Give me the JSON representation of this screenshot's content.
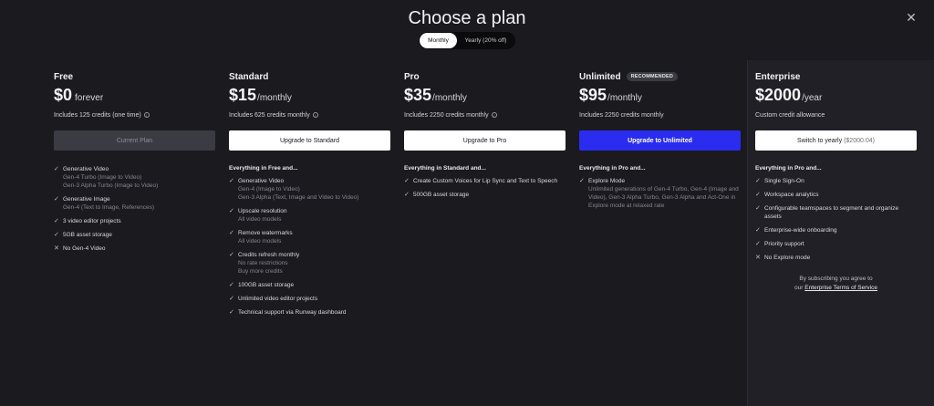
{
  "header": {
    "title": "Choose a plan",
    "close": "✕"
  },
  "billing_toggle": {
    "monthly": "Monthly",
    "yearly": "Yearly (20% off)"
  },
  "plans": {
    "free": {
      "name": "Free",
      "price": "$0",
      "period": "forever",
      "credits": "Includes 125 credits (one time)",
      "button": "Current Plan",
      "features": [
        {
          "label": "Generative Video",
          "subs": [
            "Gen-4 Turbo (Image to Video)",
            "Gen-3 Alpha Turbo (Image to Video)"
          ]
        },
        {
          "label": "Generative Image",
          "subs": [
            "Gen-4 (Text to Image, References)"
          ]
        },
        {
          "label": "3 video editor projects"
        },
        {
          "label": "5GB asset storage"
        },
        {
          "label": "No Gen-4 Video"
        }
      ]
    },
    "standard": {
      "name": "Standard",
      "price": "$15",
      "period": "/monthly",
      "credits": "Includes 625 credits monthly",
      "button": "Upgrade to Standard",
      "features_head": "Everything in Free and...",
      "features": [
        {
          "label": "Generative Video",
          "subs": [
            "Gen-4 (Image to Video)",
            "Gen-3 Alpha (Text, Image and Video to Video)"
          ]
        },
        {
          "label": "Upscale resolution",
          "subs": [
            "All video models"
          ]
        },
        {
          "label": "Remove watermarks",
          "subs": [
            "All video models"
          ]
        },
        {
          "label": "Credits refresh monthly",
          "subs": [
            "No rate restrictions",
            "Buy more credits"
          ]
        },
        {
          "label": "100GB asset storage"
        },
        {
          "label": "Unlimited video editor projects"
        },
        {
          "label": "Technical support via Runway dashboard"
        }
      ]
    },
    "pro": {
      "name": "Pro",
      "price": "$35",
      "period": "/monthly",
      "credits": "Includes 2250 credits monthly",
      "button": "Upgrade to Pro",
      "features_head": "Everything in Standard and...",
      "features": [
        {
          "label": "Create Custom Voices for Lip Sync and Text to Speech"
        },
        {
          "label": "500GB asset storage"
        }
      ]
    },
    "unlimited": {
      "name": "Unlimited",
      "badge": "RECOMMENDED",
      "price": "$95",
      "period": "/monthly",
      "credits": "Includes 2250 credits monthly",
      "button": "Upgrade to Unlimited",
      "features_head": "Everything in Pro and...",
      "features": [
        {
          "label": "Explore Mode",
          "subs": [
            "Unlimited generations of Gen-4 Turbo, Gen-4 (Image and Video), Gen-3 Alpha Turbo, Gen-3 Alpha and Act-One in Explore mode at relaxed rate"
          ]
        }
      ]
    },
    "enterprise": {
      "name": "Enterprise",
      "price": "$2000",
      "period": "/year",
      "credits": "Custom credit allowance",
      "button": "Switch to yearly",
      "button_sub": "($2000.04)",
      "features_head": "Everything in Pro and...",
      "features": [
        {
          "label": "Single Sign-On"
        },
        {
          "label": "Workspace analytics"
        },
        {
          "label": "Configurable teamspaces to segment and organize assets"
        },
        {
          "label": "Enterprise-wide onboarding"
        },
        {
          "label": "Priority support"
        },
        {
          "label": "No Explore mode"
        }
      ],
      "terms_prefix": "By subscribing you agree to",
      "terms_our": "our",
      "terms_link": "Enterprise Terms of Service"
    }
  },
  "icons": {
    "check": "check-icon",
    "cross": "x-icon",
    "info": "info-icon",
    "close": "close-icon"
  },
  "colors": {
    "background": "#1a1a1f",
    "accent": "#2a2cf0",
    "panel": "#202026"
  }
}
